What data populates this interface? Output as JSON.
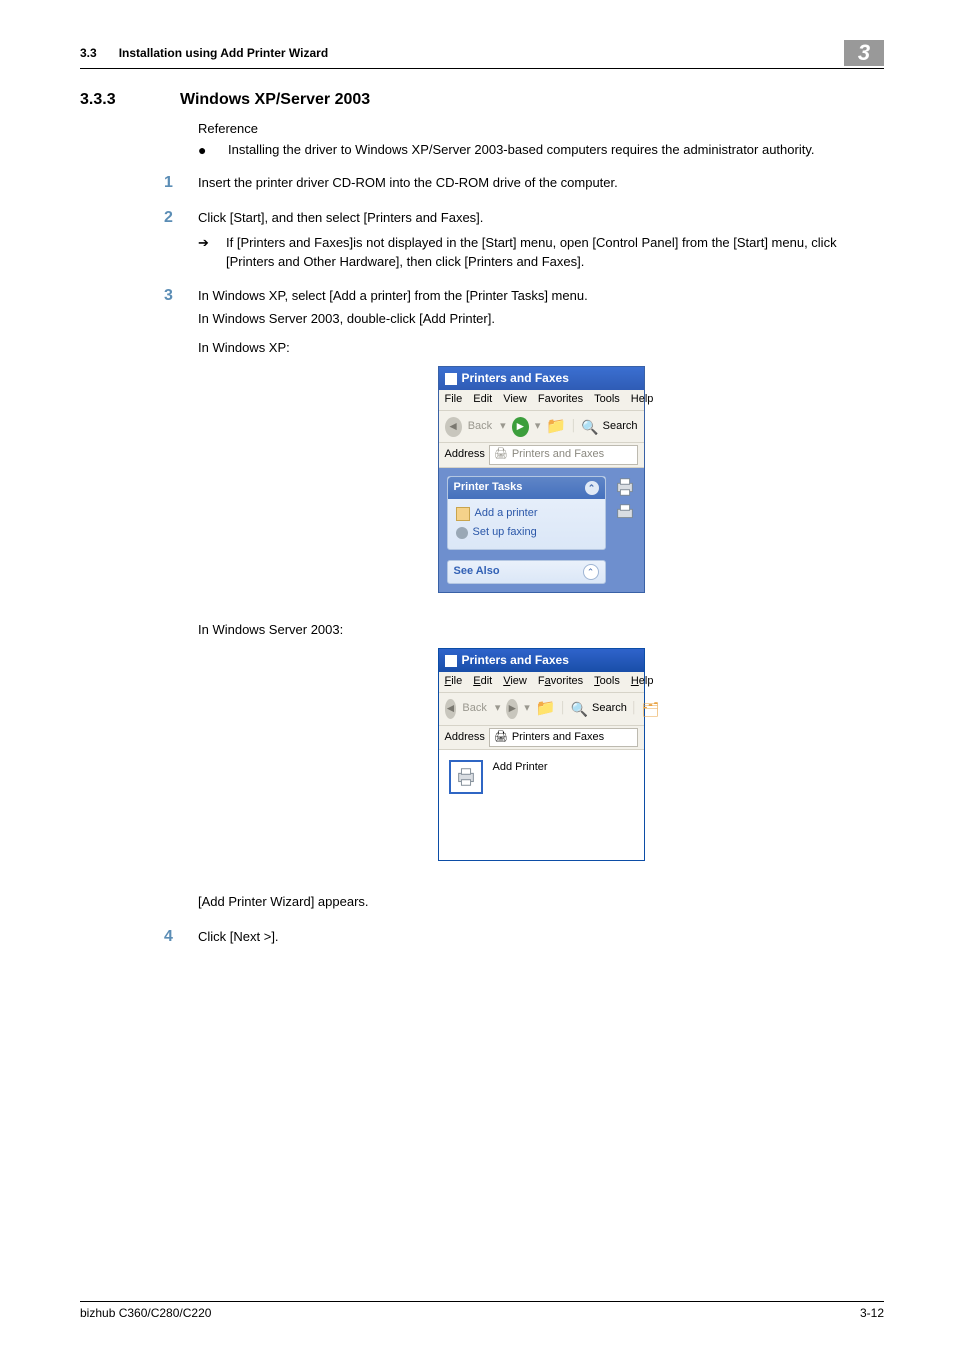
{
  "header": {
    "section_ref": "3.3",
    "section_text": "Installation using Add Printer Wizard",
    "chapter": "3"
  },
  "section": {
    "number": "3.3.3",
    "title": "Windows XP/Server 2003"
  },
  "reference": {
    "label": "Reference",
    "bullet": "Installing the driver to Windows XP/Server 2003-based computers requires the administrator authority."
  },
  "steps": {
    "s1": {
      "num": "1",
      "text": "Insert the printer driver CD-ROM into the CD-ROM drive of the computer."
    },
    "s2": {
      "num": "2",
      "text": "Click [Start], and then select [Printers and Faxes].",
      "sub": "If [Printers and Faxes]is not displayed in the [Start] menu, open [Control Panel] from the [Start] menu, click [Printers and Other Hardware], then click [Printers and Faxes]."
    },
    "s3": {
      "num": "3",
      "line1": "In Windows XP, select [Add a printer] from the [Printer Tasks] menu.",
      "line2": "In Windows Server 2003, double-click [Add Printer].",
      "caption_xp": "In Windows XP:",
      "caption_srv": "In Windows Server 2003:",
      "after": "[Add Printer Wizard] appears."
    },
    "s4": {
      "num": "4",
      "text": "Click [Next >]."
    }
  },
  "xp": {
    "title": "Printers and Faxes",
    "menu": {
      "file": "File",
      "edit": "Edit",
      "view": "View",
      "fav": "Favorites",
      "tools": "Tools",
      "help": "Help"
    },
    "back": "Back",
    "search": "Search",
    "address_label": "Address",
    "address_value": "Printers and Faxes",
    "panel_head": "Printer Tasks",
    "link_add": "Add a printer",
    "link_fax": "Set up faxing",
    "see_also": "See Also"
  },
  "srv": {
    "title": "Printers and Faxes",
    "menu": {
      "file": "File",
      "edit": "Edit",
      "view": "View",
      "fav": "Favorites",
      "tools": "Tools",
      "help": "Help"
    },
    "back": "Back",
    "search": "Search",
    "address_label": "Address",
    "address_value": "Printers and Faxes",
    "add_printer": "Add Printer"
  },
  "footer": {
    "left": "bizhub C360/C280/C220",
    "right": "3-12"
  }
}
